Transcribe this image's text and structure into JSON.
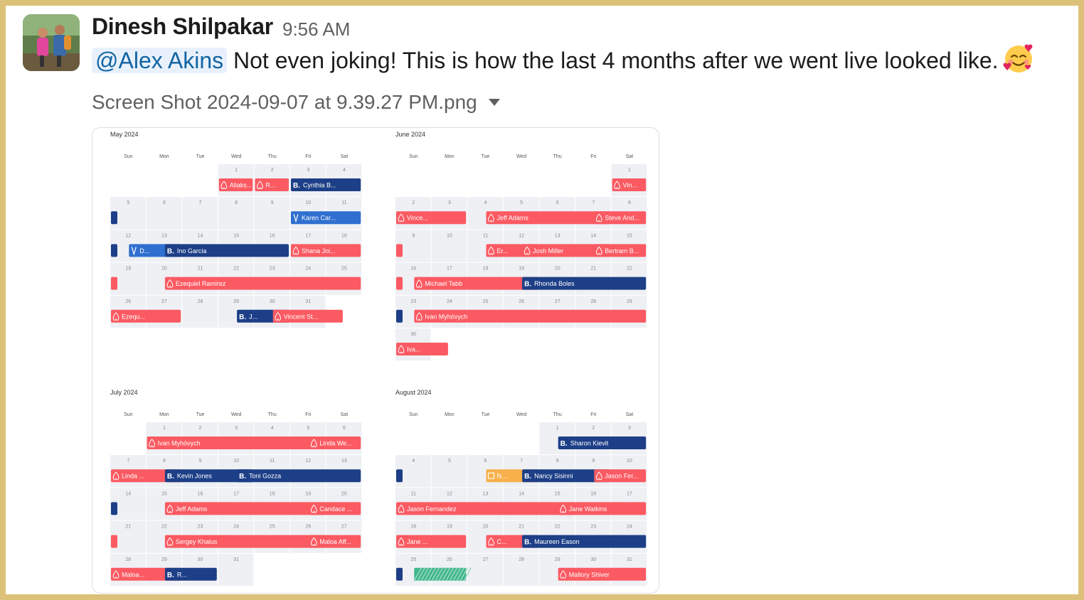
{
  "message": {
    "author": "Dinesh Shilpakar",
    "time": "9:56 AM",
    "mention": "@Alex Akins",
    "text": "Not even joking! This is how the last 4 months after we went live looked like.",
    "emoji": "smiling-face-with-hearts-icon"
  },
  "attachment": {
    "filename": "Screen Shot 2024-09-07 at 9.39.27 PM.png",
    "toggle_icon": "caret-down-icon"
  },
  "calendar": {
    "weekdays": [
      "Sun",
      "Mon",
      "Tue",
      "Wed",
      "Thu",
      "Fri",
      "Sat"
    ],
    "colors": {
      "airbnb": "#fb5a62",
      "booking": "#1d3f87",
      "vrbo": "#2f6fcf",
      "other": "#f7b04a",
      "blocked": "#3fb68c"
    },
    "months": [
      {
        "title": "May 2024",
        "first_weekday": 3,
        "days": 31,
        "events": [
          {
            "src": "airbnb",
            "week": 0,
            "start": 3,
            "end": 3,
            "label": "Aliaks..."
          },
          {
            "src": "airbnb",
            "week": 0,
            "start": 4,
            "end": 4,
            "label": "R..."
          },
          {
            "src": "booking",
            "week": 0,
            "start": 5,
            "end": 6,
            "label": "Cynthia B..."
          },
          {
            "src": "booking",
            "week": 1,
            "start": 0,
            "end": 0,
            "label": ""
          },
          {
            "src": "vrbo",
            "week": 1,
            "start": 5,
            "end": 6,
            "label": "Karen Car..."
          },
          {
            "src": "booking",
            "week": 2,
            "start": 0,
            "end": 0,
            "label": ""
          },
          {
            "src": "vrbo",
            "week": 2,
            "start": 0.5,
            "end": 1,
            "label": "D..."
          },
          {
            "src": "booking",
            "week": 2,
            "start": 1.5,
            "end": 4,
            "label": "Ino Garcia"
          },
          {
            "src": "airbnb",
            "week": 2,
            "start": 5,
            "end": 6,
            "label": "Shana Joi..."
          },
          {
            "src": "airbnb",
            "week": 3,
            "start": 0,
            "end": 0,
            "label": ""
          },
          {
            "src": "airbnb",
            "week": 3,
            "start": 1.5,
            "end": 6,
            "label": "Ezequiel Ramirez"
          },
          {
            "src": "airbnb",
            "week": 4,
            "start": 0,
            "end": 1,
            "label": "Ezequ..."
          },
          {
            "src": "booking",
            "week": 4,
            "start": 3.5,
            "end": 4,
            "label": "J..."
          },
          {
            "src": "airbnb",
            "week": 4,
            "start": 4.5,
            "end": 5.5,
            "label": "Vincent St..."
          }
        ]
      },
      {
        "title": "June 2024",
        "first_weekday": 6,
        "days": 30,
        "events": [
          {
            "src": "airbnb",
            "week": 0,
            "start": 6,
            "end": 6,
            "label": "Vin..."
          },
          {
            "src": "airbnb",
            "week": 1,
            "start": 0,
            "end": 1,
            "label": "Vince..."
          },
          {
            "src": "airbnb",
            "week": 1,
            "start": 2.5,
            "end": 5,
            "label": "Jeff Adams"
          },
          {
            "src": "airbnb",
            "week": 1,
            "start": 5.5,
            "end": 6,
            "label": "Steve And..."
          },
          {
            "src": "airbnb",
            "week": 2,
            "start": 0,
            "end": 0,
            "label": ""
          },
          {
            "src": "airbnb",
            "week": 2,
            "start": 2.5,
            "end": 3,
            "label": "Er..."
          },
          {
            "src": "airbnb",
            "week": 2,
            "start": 3.5,
            "end": 5,
            "label": "Josh Miller"
          },
          {
            "src": "airbnb",
            "week": 2,
            "start": 5.5,
            "end": 6,
            "label": "Bertram B..."
          },
          {
            "src": "airbnb",
            "week": 3,
            "start": 0,
            "end": 0,
            "label": ""
          },
          {
            "src": "airbnb",
            "week": 3,
            "start": 0.5,
            "end": 3,
            "label": "Michael Tabb"
          },
          {
            "src": "booking",
            "week": 3,
            "start": 3.5,
            "end": 6,
            "label": "Rhonda Boles"
          },
          {
            "src": "booking",
            "week": 4,
            "start": 0,
            "end": 0,
            "label": ""
          },
          {
            "src": "airbnb",
            "week": 4,
            "start": 0.5,
            "end": 6,
            "label": "Ivan Myhóvych"
          },
          {
            "src": "airbnb",
            "week": 5,
            "start": 0,
            "end": 0.5,
            "label": "Iva..."
          }
        ]
      },
      {
        "title": "July 2024",
        "first_weekday": 1,
        "days": 31,
        "events": [
          {
            "src": "airbnb",
            "week": 0,
            "start": 1,
            "end": 5,
            "label": "Ivan Myhóvych"
          },
          {
            "src": "airbnb",
            "week": 0,
            "start": 5.5,
            "end": 6,
            "label": "Linda We..."
          },
          {
            "src": "airbnb",
            "week": 1,
            "start": 0,
            "end": 1,
            "label": "Linda ..."
          },
          {
            "src": "booking",
            "week": 1,
            "start": 1.5,
            "end": 3,
            "label": "Kevin Jones"
          },
          {
            "src": "booking",
            "week": 1,
            "start": 3.5,
            "end": 6,
            "label": "Toni Gozza"
          },
          {
            "src": "booking",
            "week": 2,
            "start": 0,
            "end": 0,
            "label": ""
          },
          {
            "src": "airbnb",
            "week": 2,
            "start": 1.5,
            "end": 5,
            "label": "Jeff Adams"
          },
          {
            "src": "airbnb",
            "week": 2,
            "start": 5.5,
            "end": 6,
            "label": "Candace ..."
          },
          {
            "src": "airbnb",
            "week": 3,
            "start": 0,
            "end": 0,
            "label": ""
          },
          {
            "src": "airbnb",
            "week": 3,
            "start": 1.5,
            "end": 5,
            "label": "Sergey Khalus"
          },
          {
            "src": "airbnb",
            "week": 3,
            "start": 5.5,
            "end": 6,
            "label": "Maloa Aff..."
          },
          {
            "src": "airbnb",
            "week": 4,
            "start": 0,
            "end": 1,
            "label": "Maloa..."
          },
          {
            "src": "booking",
            "week": 4,
            "start": 1.5,
            "end": 2,
            "label": "R..."
          }
        ]
      },
      {
        "title": "August 2024",
        "first_weekday": 4,
        "days": 31,
        "events": [
          {
            "src": "booking",
            "week": 0,
            "start": 4.5,
            "end": 6,
            "label": "Sharon Kievit"
          },
          {
            "src": "booking",
            "week": 1,
            "start": 0,
            "end": 0,
            "label": ""
          },
          {
            "src": "other",
            "week": 1,
            "start": 2.5,
            "end": 3,
            "label": "N..."
          },
          {
            "src": "booking",
            "week": 1,
            "start": 3.5,
            "end": 5,
            "label": "Nancy Sisinni"
          },
          {
            "src": "airbnb",
            "week": 1,
            "start": 5.5,
            "end": 6,
            "label": "Jason Fer..."
          },
          {
            "src": "airbnb",
            "week": 2,
            "start": 0,
            "end": 4,
            "label": "Jason Fernandez"
          },
          {
            "src": "airbnb",
            "week": 2,
            "start": 4.5,
            "end": 6,
            "label": "Jane Watkins"
          },
          {
            "src": "airbnb",
            "week": 3,
            "start": 0,
            "end": 1,
            "label": "Jane ..."
          },
          {
            "src": "airbnb",
            "week": 3,
            "start": 2.5,
            "end": 3,
            "label": "C..."
          },
          {
            "src": "booking",
            "week": 3,
            "start": 3.5,
            "end": 6,
            "label": "Maureen Eason"
          },
          {
            "src": "booking",
            "week": 4,
            "start": 0,
            "end": 0,
            "label": ""
          },
          {
            "src": "blocked",
            "week": 4,
            "start": 0.5,
            "end": 1,
            "label": ""
          },
          {
            "src": "airbnb",
            "week": 4,
            "start": 4.5,
            "end": 6,
            "label": "Mallory Shiver"
          }
        ]
      }
    ]
  }
}
